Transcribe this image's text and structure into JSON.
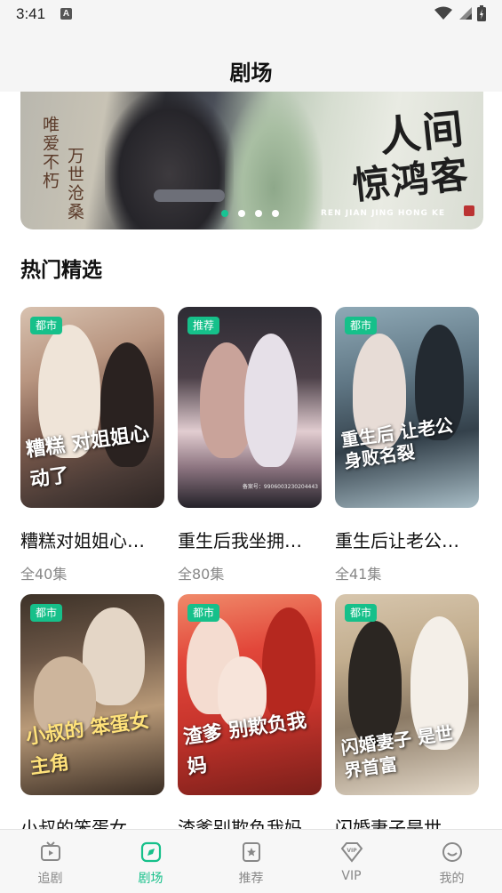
{
  "status_bar": {
    "time": "3:41",
    "notification_letter": "A"
  },
  "header": {
    "title": "剧场"
  },
  "banner": {
    "left_text": [
      "唯爱不朽",
      "万世沧桑"
    ],
    "title_line1": "人间",
    "title_line2": "惊鸿客",
    "pinyin": "REN JIAN JING HONG KE",
    "dots": 4,
    "active_dot": 0
  },
  "section": {
    "title": "热门精选"
  },
  "dramas": [
    {
      "tag": "都市",
      "title": "糟糕对姐姐心…",
      "episodes": "全40集",
      "caption": "糟糕 对姐姐心动了"
    },
    {
      "tag": "推荐",
      "title": "重生后我坐拥…",
      "episodes": "全80集",
      "caption": "",
      "small": "备案号：9906003230204443"
    },
    {
      "tag": "都市",
      "title": "重生后让老公…",
      "episodes": "全41集",
      "caption": "重生后 让老公 身败名裂"
    },
    {
      "tag": "都市",
      "title": "小叔的笨蛋女…",
      "episodes": "",
      "caption": "小叔的 笨蛋女主角"
    },
    {
      "tag": "都市",
      "title": "渣爹别欺负我妈",
      "episodes": "",
      "caption": "渣爹 别欺负我妈"
    },
    {
      "tag": "都市",
      "title": "闪婚妻子是世…",
      "episodes": "",
      "caption": "闪婚妻子 是世界首富"
    }
  ],
  "bottom_nav": [
    {
      "label": "追剧",
      "icon": "tv-icon",
      "active": false
    },
    {
      "label": "剧场",
      "icon": "theater-icon",
      "active": true
    },
    {
      "label": "推荐",
      "icon": "star-card-icon",
      "active": false
    },
    {
      "label": "VIP",
      "icon": "vip-diamond-icon",
      "active": false
    },
    {
      "label": "我的",
      "icon": "smile-face-icon",
      "active": false
    }
  ],
  "colors": {
    "accent": "#16c08a",
    "tag_bg": "#16c08a",
    "inactive": "#888888"
  }
}
